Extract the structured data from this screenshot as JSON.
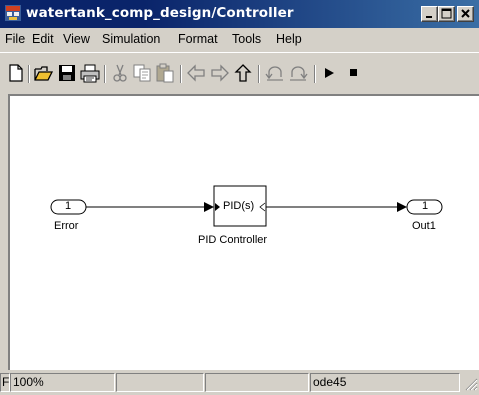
{
  "window": {
    "title": "watertank_comp_design/Controller"
  },
  "menu": {
    "items": [
      "File",
      "Edit",
      "View",
      "Simulation",
      "Format",
      "Tools",
      "Help"
    ]
  },
  "toolbar": {
    "icons": [
      "new-file-icon",
      "open-folder-icon",
      "save-icon",
      "print-icon",
      "cut-icon",
      "copy-icon",
      "paste-icon",
      "back-arrow-icon",
      "forward-arrow-icon",
      "up-arrow-icon",
      "undo-icon",
      "redo-icon",
      "start-simulation-icon",
      "stop-simulation-icon"
    ]
  },
  "diagram": {
    "inport": {
      "number": "1",
      "label": "Error"
    },
    "pid_block": {
      "text": "PID(s)",
      "label": "PID Controller"
    },
    "outport": {
      "number": "1",
      "label": "Out1"
    }
  },
  "status": {
    "left": "F",
    "zoom": "100%",
    "cell2": "",
    "cell3": "",
    "solver": "ode45"
  },
  "colors": {
    "titlebar_start": "#0a246a",
    "titlebar_end": "#3a6ea5",
    "chrome": "#d4d0c8",
    "canvas": "#ffffff"
  }
}
